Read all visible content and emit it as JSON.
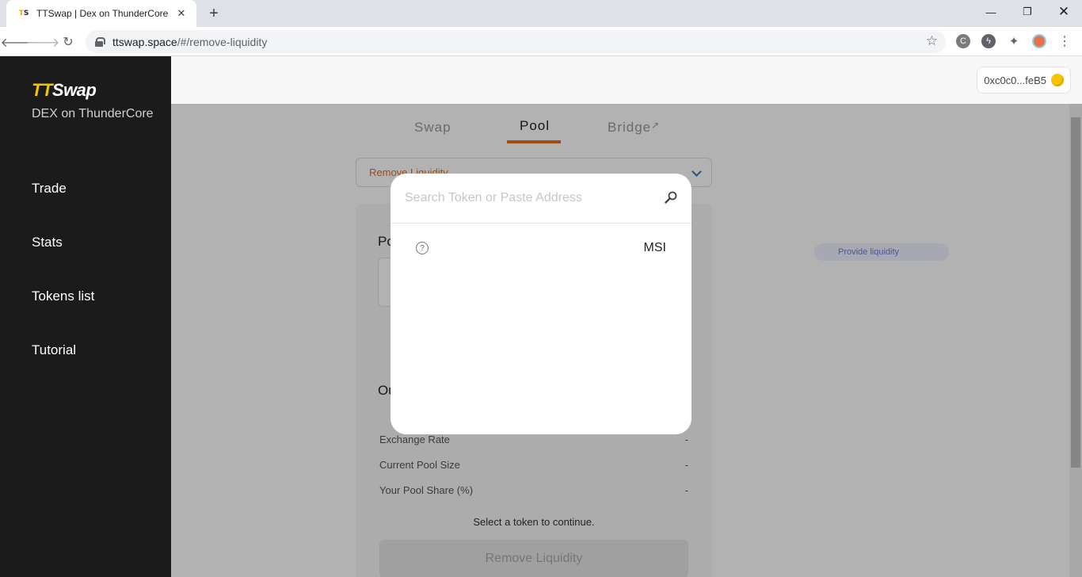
{
  "browser": {
    "tab_title": "TTSwap | Dex on ThunderCore",
    "favicon_text": "TS",
    "url_host": "ttswap.space",
    "url_path": "/#/remove-liquidity"
  },
  "sidebar": {
    "logo": "TTSwap",
    "logo_prefix": "TT",
    "logo_suffix": "Swap",
    "tagline": "DEX on ThunderCore",
    "items": [
      {
        "label": "Trade"
      },
      {
        "label": "Stats"
      },
      {
        "label": "Tokens list"
      },
      {
        "label": "Tutorial"
      }
    ]
  },
  "header": {
    "wallet_address": "0xc0c0...feB5"
  },
  "main": {
    "tabs": [
      {
        "label": "Swap"
      },
      {
        "label": "Pool"
      },
      {
        "label": "Bridge"
      }
    ],
    "bridge_arrow": "↗",
    "mode_label": "Remove Liquidity",
    "pool_heading": "Po",
    "output_heading": "Ou",
    "info_rows": [
      {
        "label": "Exchange Rate",
        "value": "-"
      },
      {
        "label": "Current Pool Size",
        "value": "-"
      },
      {
        "label": "Your Pool Share (%)",
        "value": "-"
      }
    ],
    "hint": "Select a token to continue.",
    "remove_button": "Remove Liquidity",
    "faded_pill": "Provide liquidity"
  },
  "modal": {
    "search_placeholder": "Search Token or Paste Address",
    "search_value": "",
    "tokens": [
      {
        "symbol": "MSI",
        "icon": "unknown-token-icon"
      }
    ]
  },
  "colors": {
    "accent": "#e86d1f",
    "logo_yellow": "#f5c400",
    "sidebar_bg": "#1b1b1b"
  }
}
